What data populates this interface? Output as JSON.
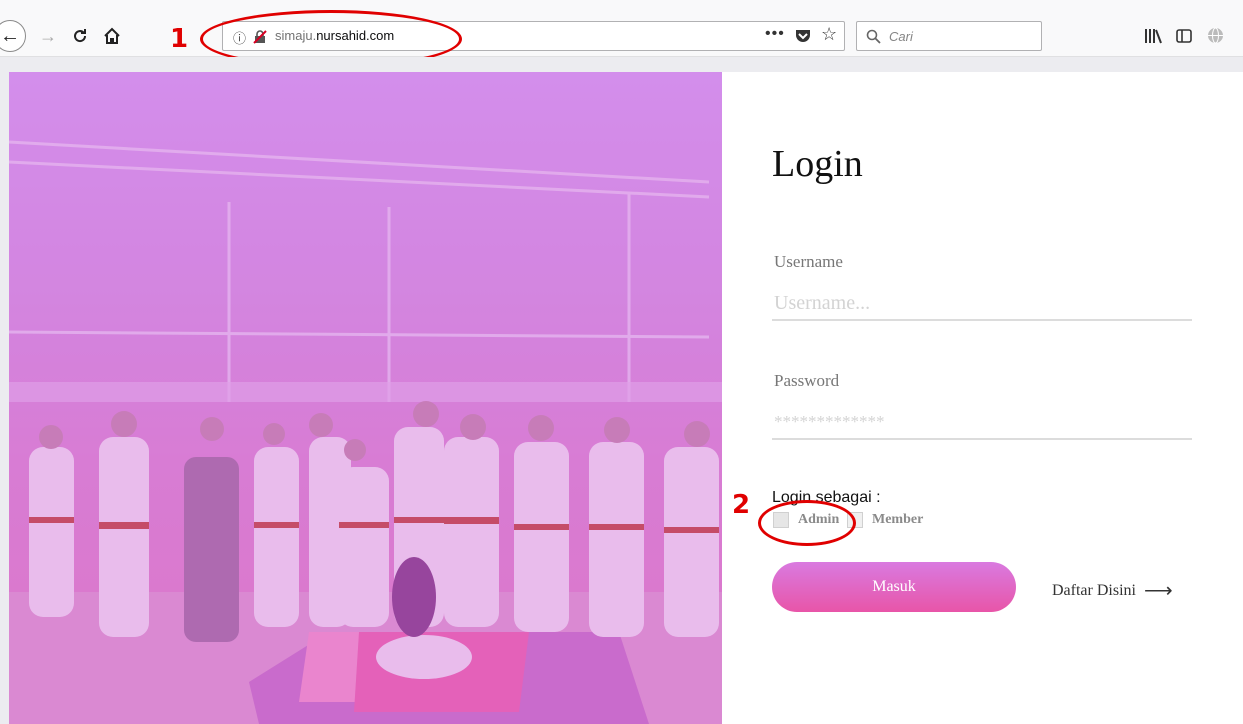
{
  "browser": {
    "url_prefix": "simaju.",
    "url_host": "nursahid.com",
    "search_placeholder": "Cari"
  },
  "annotations": {
    "first": "1",
    "second": "2"
  },
  "form": {
    "title": "Login",
    "username_label": "Username",
    "username_placeholder": "Username...",
    "password_label": "Password",
    "password_placeholder": "*************",
    "role_label": "Login sebagai :",
    "role_options": [
      "Admin",
      "Member"
    ],
    "submit_label": "Masuk",
    "register_label": "Daftar Disini"
  },
  "colors": {
    "accent_top": "#d97ae0",
    "accent_bottom": "#e855a8",
    "annotation": "#e00000"
  }
}
